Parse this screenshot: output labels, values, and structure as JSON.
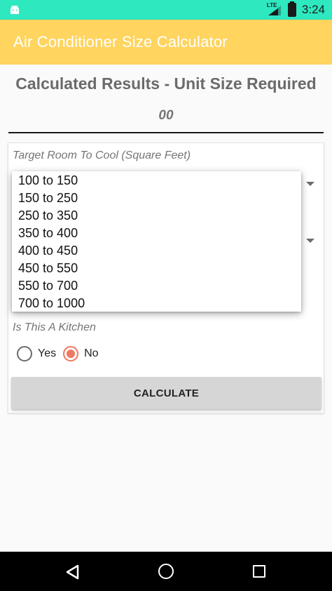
{
  "status_bar": {
    "network_label": "LTE",
    "time": "3:24",
    "background": "#2ee8c0",
    "icons": [
      "android-icon",
      "signal-icon",
      "battery-icon"
    ]
  },
  "app_bar": {
    "title": "Air Conditioner Size Calculator",
    "background": "#ffd45f"
  },
  "results": {
    "heading": "Calculated Results - Unit Size Required",
    "value": "00"
  },
  "form": {
    "room_label": "Target Room To Cool (Square Feet)",
    "kitchen_label": "Is This A Kitchen",
    "kitchen_options": [
      {
        "label": "Yes",
        "checked": false
      },
      {
        "label": "No",
        "checked": true
      }
    ],
    "calculate_label": "CALCULATE",
    "accent_color": "#f07860"
  },
  "dropdown": {
    "options": [
      "100 to 150",
      "150 to 250",
      "250 to 350",
      "350 to 400",
      "400 to 450",
      "450 to 550",
      "550 to 700",
      "700 to 1000"
    ]
  },
  "nav_bar": {
    "icons": [
      "back-icon",
      "home-icon",
      "recent-apps-icon"
    ]
  }
}
